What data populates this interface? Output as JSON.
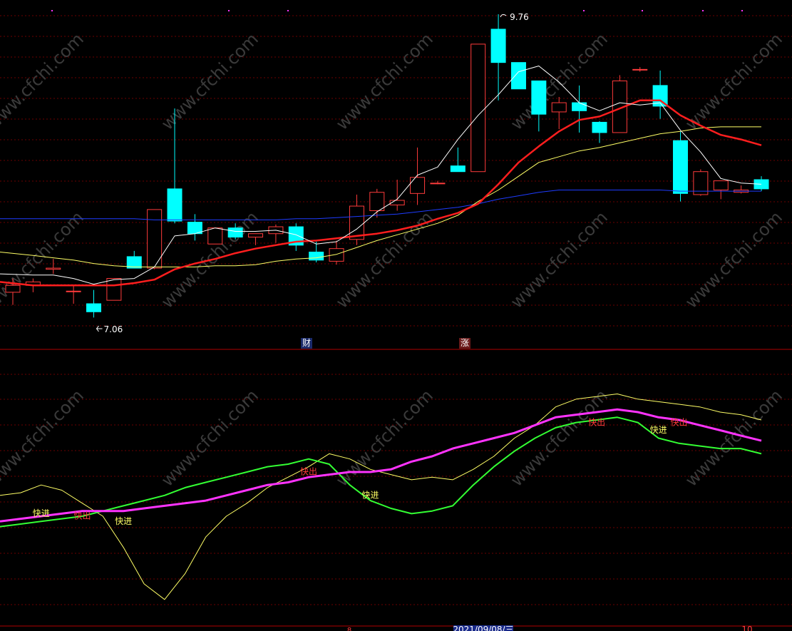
{
  "chart_data": [
    {
      "type": "candlestick",
      "annotations": {
        "high_label": "9.76",
        "low_label": "7.06",
        "marker_cai": "财",
        "marker_zhang": "涨"
      },
      "colors": {
        "up": "#ff3b3b",
        "down": "#00ffff",
        "ma_short": "#ffffff",
        "ma_mid": "#ff1e1e",
        "ma_long": "#ffff66",
        "ma_longest": "#1e3cff"
      },
      "candles": [
        {
          "o": 7.34,
          "h": 7.46,
          "l": 7.23,
          "c": 7.4
        },
        {
          "o": 7.4,
          "h": 7.46,
          "l": 7.34,
          "c": 7.43
        },
        {
          "o": 7.54,
          "h": 7.63,
          "l": 7.5,
          "c": 7.55
        },
        {
          "o": 7.35,
          "h": 7.4,
          "l": 7.24,
          "c": 7.35
        },
        {
          "o": 7.24,
          "h": 7.36,
          "l": 7.12,
          "c": 7.17
        },
        {
          "o": 7.27,
          "h": 7.45,
          "l": 7.27,
          "c": 7.46
        },
        {
          "o": 7.65,
          "h": 7.7,
          "l": 7.6,
          "c": 7.55
        },
        {
          "o": 7.55,
          "h": 7.58,
          "l": 7.54,
          "c": 8.06
        },
        {
          "o": 8.24,
          "h": 8.94,
          "l": 7.94,
          "c": 7.96
        },
        {
          "o": 7.95,
          "h": 8.02,
          "l": 7.79,
          "c": 7.85
        },
        {
          "o": 7.76,
          "h": 7.8,
          "l": 7.77,
          "c": 7.9
        },
        {
          "o": 7.9,
          "h": 7.94,
          "l": 7.8,
          "c": 7.82
        },
        {
          "o": 7.82,
          "h": 7.85,
          "l": 7.75,
          "c": 7.85
        },
        {
          "o": 7.85,
          "h": 7.93,
          "l": 7.77,
          "c": 7.91
        },
        {
          "o": 7.91,
          "h": 7.94,
          "l": 7.7,
          "c": 7.75
        },
        {
          "o": 7.69,
          "h": 7.78,
          "l": 7.6,
          "c": 7.62
        },
        {
          "o": 7.61,
          "h": 7.79,
          "l": 7.58,
          "c": 7.72
        },
        {
          "o": 7.8,
          "h": 8.19,
          "l": 7.75,
          "c": 8.09
        },
        {
          "o": 8.05,
          "h": 8.24,
          "l": 7.99,
          "c": 8.21
        },
        {
          "o": 8.1,
          "h": 8.32,
          "l": 8.05,
          "c": 8.14
        },
        {
          "o": 8.2,
          "h": 8.6,
          "l": 8.1,
          "c": 8.34
        },
        {
          "o": 8.29,
          "h": 8.31,
          "l": 8.28,
          "c": 8.29
        },
        {
          "o": 8.44,
          "h": 8.6,
          "l": 8.43,
          "c": 8.39
        },
        {
          "o": 8.39,
          "h": 9.5,
          "l": 8.39,
          "c": 9.5
        },
        {
          "o": 9.63,
          "h": 9.76,
          "l": 9.01,
          "c": 9.34
        },
        {
          "o": 9.34,
          "h": 9.26,
          "l": 9.25,
          "c": 9.11
        },
        {
          "o": 9.18,
          "h": 9.18,
          "l": 8.74,
          "c": 8.89
        },
        {
          "o": 8.91,
          "h": 9.04,
          "l": 8.76,
          "c": 8.99
        },
        {
          "o": 8.99,
          "h": 9.14,
          "l": 8.73,
          "c": 8.92
        },
        {
          "o": 8.82,
          "h": 8.83,
          "l": 8.64,
          "c": 8.73
        },
        {
          "o": 8.73,
          "h": 9.23,
          "l": 8.73,
          "c": 9.18
        },
        {
          "o": 9.28,
          "h": 9.3,
          "l": 9.26,
          "c": 9.28
        },
        {
          "o": 9.14,
          "h": 9.27,
          "l": 8.85,
          "c": 8.96
        },
        {
          "o": 8.66,
          "h": 8.74,
          "l": 8.13,
          "c": 8.2
        },
        {
          "o": 8.19,
          "h": 8.41,
          "l": 8.18,
          "c": 8.39
        },
        {
          "o": 8.23,
          "h": 8.31,
          "l": 8.15,
          "c": 8.31
        },
        {
          "o": 8.21,
          "h": 8.27,
          "l": 8.2,
          "c": 8.23
        },
        {
          "o": 8.32,
          "h": 8.35,
          "l": 8.22,
          "c": 8.24
        }
      ],
      "ma_short": [
        7.5,
        7.49,
        7.49,
        7.46,
        7.41,
        7.45,
        7.46,
        7.56,
        7.83,
        7.85,
        7.9,
        7.87,
        7.87,
        7.88,
        7.84,
        7.76,
        7.78,
        7.89,
        8.04,
        8.15,
        8.36,
        8.43,
        8.67,
        8.88,
        9.06,
        9.26,
        9.31,
        9.17,
        8.99,
        8.92,
        8.99,
        8.97,
        8.99,
        8.75,
        8.56,
        8.33,
        8.29,
        8.28
      ],
      "ma_mid": [
        7.43,
        7.4,
        7.4,
        7.4,
        7.4,
        7.4,
        7.42,
        7.45,
        7.54,
        7.59,
        7.63,
        7.68,
        7.72,
        7.75,
        7.78,
        7.79,
        7.81,
        7.83,
        7.85,
        7.88,
        7.92,
        7.98,
        8.03,
        8.11,
        8.28,
        8.47,
        8.61,
        8.74,
        8.84,
        8.87,
        8.94,
        9.01,
        9.01,
        8.88,
        8.79,
        8.71,
        8.67,
        8.62
      ],
      "ma_long": [
        7.69,
        7.66,
        7.64,
        7.62,
        7.59,
        7.57,
        7.56,
        7.56,
        7.56,
        7.56,
        7.57,
        7.57,
        7.58,
        7.61,
        7.63,
        7.64,
        7.67,
        7.73,
        7.79,
        7.84,
        7.89,
        7.94,
        8.01,
        8.13,
        8.23,
        8.35,
        8.47,
        8.52,
        8.57,
        8.6,
        8.64,
        8.68,
        8.72,
        8.74,
        8.77,
        8.78,
        8.78,
        8.78
      ],
      "ma_longest": [
        7.98,
        7.98,
        7.98,
        7.98,
        7.98,
        7.98,
        7.98,
        7.97,
        7.97,
        7.97,
        7.97,
        7.97,
        7.97,
        7.97,
        7.98,
        7.98,
        7.99,
        8.0,
        8.01,
        8.02,
        8.04,
        8.06,
        8.08,
        8.11,
        8.15,
        8.18,
        8.21,
        8.23,
        8.23,
        8.23,
        8.23,
        8.23,
        8.23,
        8.22,
        8.22,
        8.22,
        8.22,
        8.22
      ]
    },
    {
      "type": "line",
      "labels": {
        "buy": "快进",
        "sell": "快出"
      },
      "series": [
        {
          "values": [
            38,
            39,
            40,
            41,
            42,
            42,
            42,
            43,
            44,
            45,
            46,
            48,
            50,
            52,
            53,
            55,
            56,
            57,
            57,
            58,
            61,
            63,
            66,
            68,
            70,
            72,
            75,
            78,
            79,
            80,
            81,
            80,
            78,
            77,
            75,
            73,
            71,
            69
          ]
        },
        {
          "values": [
            36,
            37,
            38,
            39,
            40,
            42,
            44,
            46,
            48,
            51,
            53,
            55,
            57,
            59,
            60,
            62,
            60,
            52,
            46,
            43,
            41,
            42,
            44,
            52,
            59,
            65,
            70,
            74,
            76,
            77,
            78,
            76,
            70,
            68,
            67,
            66,
            66,
            64
          ]
        },
        {
          "values": [
            48,
            49,
            52,
            50,
            45,
            40,
            28,
            14,
            8,
            18,
            32,
            40,
            45,
            51,
            55,
            59,
            64,
            62,
            58,
            56,
            54,
            55,
            54,
            58,
            63,
            70,
            75,
            82,
            85,
            86,
            87,
            85,
            84,
            83,
            82,
            80,
            79,
            77
          ]
        }
      ],
      "series_colors": [
        "#ff33ff",
        "#33ff33",
        "#ffff66"
      ],
      "ylim": [
        0,
        100
      ]
    }
  ],
  "footer": {
    "label_mid": "2021/09/08/三",
    "label_right": "10",
    "label_left_small": "8"
  }
}
